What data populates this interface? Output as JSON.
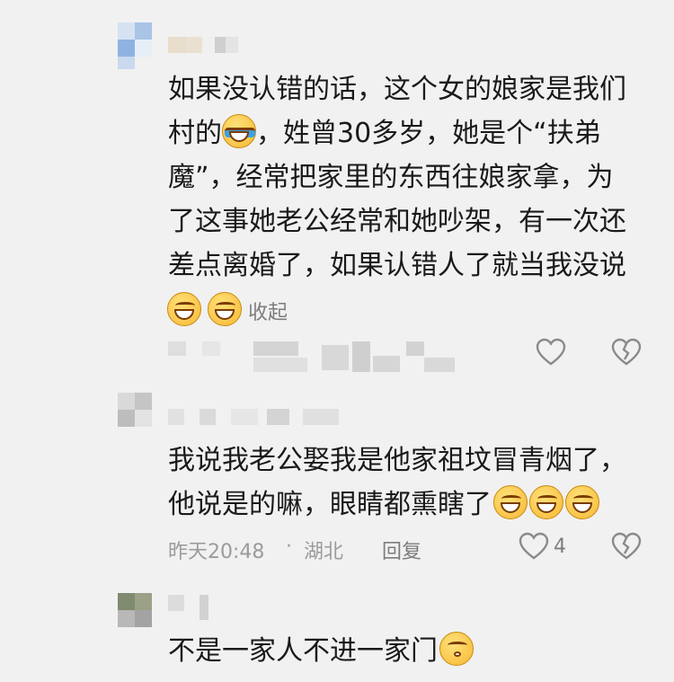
{
  "comments": [
    {
      "lines": [
        "如果没认错的话，这个女的娘家是我们",
        "村的",
        "，姓曾30多岁，她是个“扶弟",
        "魔”，经常把家里的东西往娘家拿，为",
        "了这事她老公经常和她吵架，有一次还",
        "差点离婚了，如果认错人了就当我没说"
      ],
      "collapse_label": "收起"
    },
    {
      "lines": [
        "我说我老公娶我是他家祖坟冒青烟了，",
        "他说是的嘛，眼睛都熏瞎了"
      ],
      "time": "昨天20:48",
      "separator": "·",
      "location": "湖北",
      "reply_label": "回复",
      "like_count": "4"
    },
    {
      "lines": [
        "不是一家人不进一家门"
      ]
    }
  ],
  "icons": {
    "like": "heart-outline-icon",
    "dislike": "broken-heart-icon",
    "emoji_grin": "grinning-sweat-emoji",
    "emoji_cry": "crying-laughing-emoji",
    "emoji_kiss": "kissing-blush-emoji"
  },
  "colors": {
    "background": "#f1f1f1",
    "text": "#1a1a1a",
    "meta": "#9b9b9b",
    "icon": "#8a8a8a"
  }
}
